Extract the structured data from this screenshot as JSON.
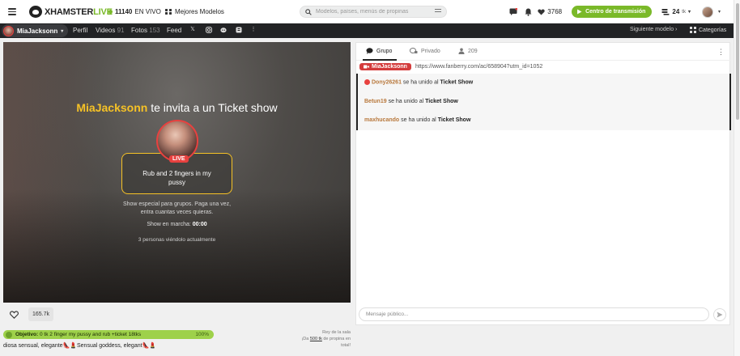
{
  "header": {
    "logo_text": "XHAMSTER",
    "logo_live": "LIVE",
    "live_count": "11140",
    "live_label": "EN VIVO",
    "top_models_label": "Mejores Modelos",
    "search_placeholder": "Modelos, países, menús de propinas",
    "tokens_count": "3768",
    "broadcast_label": "Centro de transmisión",
    "balance": "24",
    "balance_unit": "tk"
  },
  "model_bar": {
    "model_name": "MiaJacksonn",
    "profile_label": "Perfil",
    "videos_label": "Videos",
    "videos_count": "91",
    "photos_label": "Fotos",
    "photos_count": "153",
    "feed_label": "Feed",
    "next_model_label": "Siguiente modelo",
    "categories_label": "Categorías"
  },
  "video": {
    "invite_name": "MiaJacksonn",
    "invite_text": "te invita a un Ticket show",
    "live_badge": "LIVE",
    "show_title": "Rub and 2 fingers in my pussy",
    "show_desc_line1": "Show especial para grupos. Paga una vez,",
    "show_desc_line2": "entra cuantas veces quieras.",
    "running_label": "Show en marcha:",
    "running_time": "00:00",
    "viewers_text": "3 personas viéndolo actualmente"
  },
  "below_video": {
    "favorites_count": "165.7k",
    "goal_prefix": "Objetivo:",
    "goal_text": "0 tk 2 finger my pussy and rub +ticket 18tks",
    "goal_percent": "100%",
    "goal_progress": 1.0,
    "room_king_line1": "Rey de la sala",
    "room_king_line2_pre": "¡Da",
    "room_king_amount": "500 tk",
    "room_king_line2_post": "de propina en total!",
    "topic": "diosa sensual, elegante👠💄Sensual goddess, elegant👠💄"
  },
  "chat": {
    "tab_group": "Grupo",
    "tab_private": "Privado",
    "tab_users_count": "209",
    "pinned_name": "MiaJacksonn",
    "pinned_link": "https://www.fanberry.com/ac/658904?utm_id=1052",
    "messages": [
      {
        "user": "Dony26261",
        "text": "se ha unido al",
        "bold": "Ticket Show"
      },
      {
        "user": "Betun19",
        "text": "se ha unido al",
        "bold": "Ticket Show"
      },
      {
        "user": "maxhucando",
        "text": "se ha unido al",
        "bold": "Ticket Show"
      }
    ],
    "input_placeholder": "Mensaje público..."
  },
  "colors": {
    "brand_green": "#7ab929",
    "accent_yellow": "#f6c226",
    "live_red": "#e8413f",
    "username_orange": "#b8783c"
  }
}
